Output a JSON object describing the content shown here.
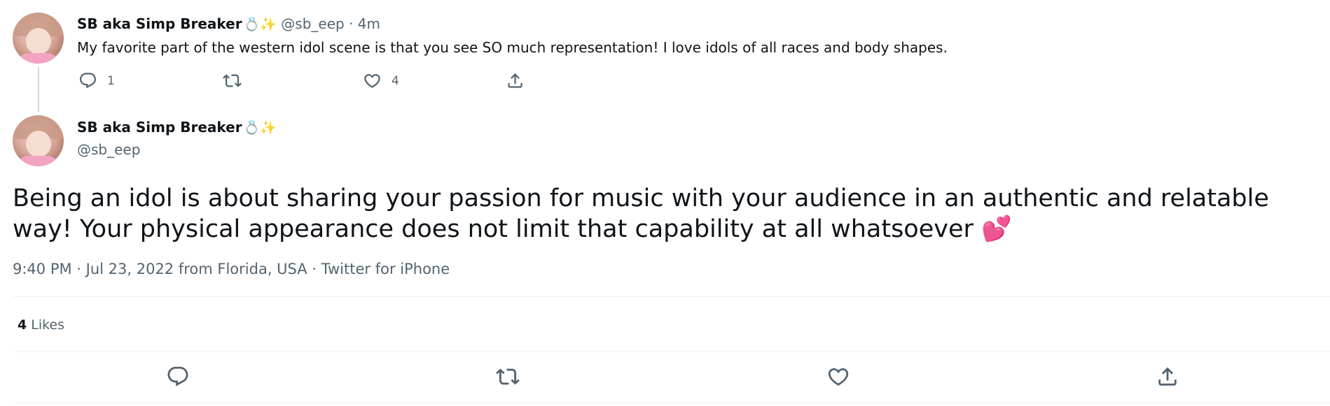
{
  "reply_tweet": {
    "display_name": "SB aka Simp Breaker",
    "name_emojis": "💍✨",
    "handle": "@sb_eep",
    "separator": "·",
    "time_ago": "4m",
    "text": "My favorite part of the western idol scene is that you see SO much representation! I love idols of all races and body shapes.",
    "reply_count": "1",
    "like_count": "4"
  },
  "main_tweet": {
    "display_name": "SB aka Simp Breaker",
    "name_emojis": "💍✨",
    "handle": "@sb_eep",
    "text": "Being an idol is about sharing your passion for music with your audience in an authentic and relatable way! Your physical appearance does not limit that capability at all whatsoever 💕",
    "timestamp": "9:40 PM · Jul 23, 2022 from Florida, USA · Twitter for iPhone",
    "likes_count": "4",
    "likes_label": "Likes"
  },
  "icons": {
    "reply": "reply-icon",
    "retweet": "retweet-icon",
    "like": "heart-icon",
    "share": "share-icon"
  },
  "colors": {
    "text_primary": "#0f1419",
    "text_secondary": "#536471",
    "thread_line": "#cfd9de",
    "divider": "#eff3f4"
  }
}
